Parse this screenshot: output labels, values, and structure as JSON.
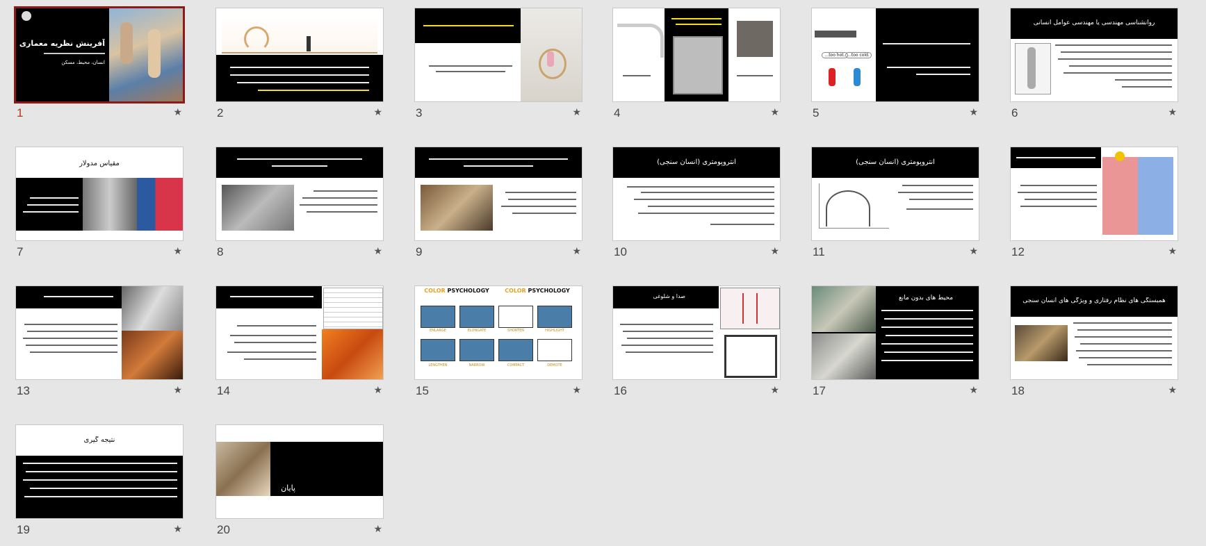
{
  "colors": {
    "background": "#e6e6e6",
    "selected_border": "#8b1a1a",
    "selected_number": "#b33a1a",
    "star": "#555555",
    "highlight": "#f2e01a"
  },
  "star_icon": "★",
  "slides": [
    {
      "number": "1",
      "title": "آفرینش نظریه معماری",
      "subtitle": "انسان، محیط، مسکن",
      "selected": true
    },
    {
      "number": "2"
    },
    {
      "number": "3"
    },
    {
      "number": "4"
    },
    {
      "number": "5",
      "bubble_left": "...too hot.",
      "bubble_right": "...too cold."
    },
    {
      "number": "6",
      "title": "روانشناسی مهندسی یا مهندسی عوامل انسانی"
    },
    {
      "number": "7",
      "title": "مقیاس مدولار"
    },
    {
      "number": "8"
    },
    {
      "number": "9"
    },
    {
      "number": "10",
      "title": "آنتروپومتری (انسان سنجی)"
    },
    {
      "number": "11",
      "title": "آنتروپومتری (انسان سنجی)"
    },
    {
      "number": "12"
    },
    {
      "number": "13"
    },
    {
      "number": "14"
    },
    {
      "number": "15",
      "heading_a": "COLOR",
      "heading_b": "PSYCHOLOGY",
      "labels": [
        "ENLARGE",
        "ELONGATE",
        "SHORTEN",
        "HIGHLIGHT",
        "LENGTHEN",
        "NARROW",
        "COMPACT",
        "DEMOTE"
      ]
    },
    {
      "number": "16",
      "title": "صدا و شلوغی"
    },
    {
      "number": "17",
      "title": "محیط های بدون مانع"
    },
    {
      "number": "18",
      "title": "همبستگی های نظام رفتاری و ویژگی های انسان سنجی"
    },
    {
      "number": "19",
      "title": "نتیجه گیری"
    },
    {
      "number": "20",
      "title": "پایان"
    }
  ]
}
